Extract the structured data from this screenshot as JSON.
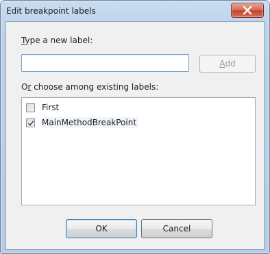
{
  "window": {
    "title": "Edit breakpoint labels",
    "close_icon": "close-icon"
  },
  "new_label": {
    "prompt_first": "T",
    "prompt_rest": "ype a new label:",
    "value": "",
    "placeholder": ""
  },
  "add_button": {
    "label_first": "A",
    "label_rest": "dd",
    "enabled": false
  },
  "existing": {
    "prompt_before": "O",
    "prompt_key": "r",
    "prompt_rest": " choose among existing labels:",
    "items": [
      {
        "label": "First",
        "checked": false
      },
      {
        "label": "MainMethodBreakPoint",
        "checked": true
      }
    ]
  },
  "footer": {
    "ok_label": "OK",
    "cancel_label": "Cancel"
  },
  "colors": {
    "title_bar": "#bcd2ea",
    "close_button": "#c2432c",
    "client_bg": "#f0f0f0"
  }
}
